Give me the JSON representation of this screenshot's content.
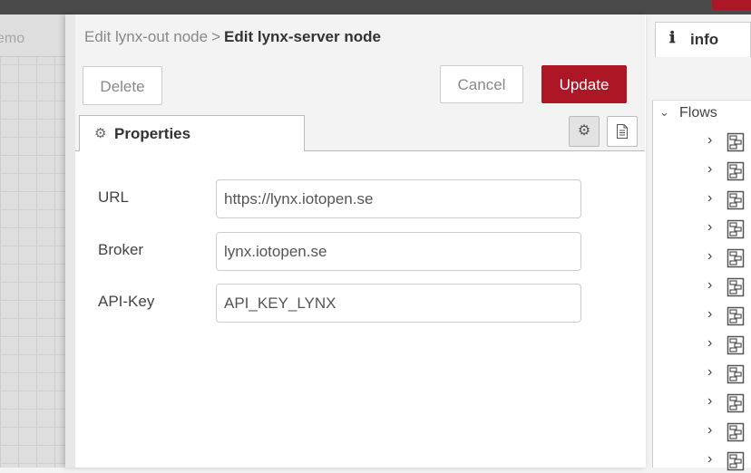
{
  "canvas": {
    "tab_label": "emo"
  },
  "editor": {
    "breadcrumb_parent": "Edit lynx-out node",
    "breadcrumb_separator": ">",
    "breadcrumb_current": "Edit lynx-server node",
    "delete_label": "Delete",
    "cancel_label": "Cancel",
    "update_label": "Update",
    "accent_color": "#ad1625",
    "tab_properties": "Properties",
    "tab_properties_icon": "gear-icon",
    "fields": [
      {
        "label": "URL",
        "value": "https://lynx.iotopen.se"
      },
      {
        "label": "Broker",
        "value": "lynx.iotopen.se"
      },
      {
        "label": "API-Key",
        "value": "API_KEY_LYNX"
      }
    ]
  },
  "sidebar": {
    "tab_label": "info",
    "tab_icon": "info-icon",
    "flows_label": "Flows",
    "flow_item_icon": "flow-icon",
    "flow_item_count": 12
  }
}
